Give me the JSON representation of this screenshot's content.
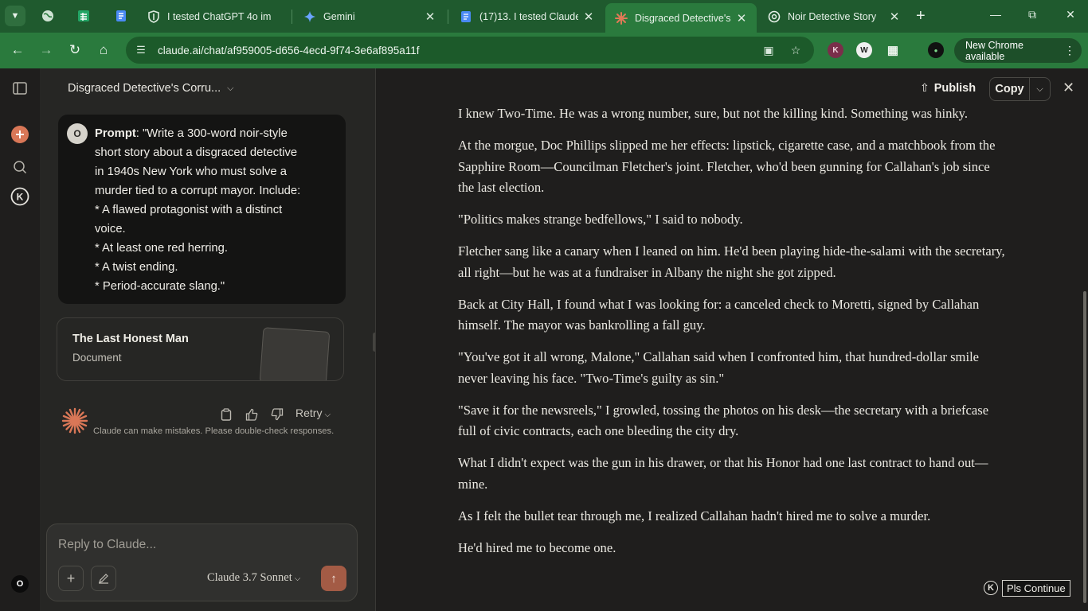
{
  "browser": {
    "tabs": [
      {
        "title": "I tested ChatGPT 4o im",
        "icon": "shield-icon",
        "active": false
      },
      {
        "title": "Gemini",
        "icon": "gemini-star-icon",
        "active": false
      },
      {
        "title": "(17)13. I tested Claude",
        "icon": "docs-icon",
        "active": false
      },
      {
        "title": "Disgraced Detective's C",
        "icon": "claude-spark-icon",
        "active": true
      },
      {
        "title": "Noir Detective Story",
        "icon": "chatgpt-icon",
        "active": false
      }
    ],
    "url": "claude.ai/chat/af959005-d656-4ecd-9f74-3e6af895a11f",
    "update_label": "New Chrome available"
  },
  "chat": {
    "title": "Disgraced Detective's Corru...",
    "user_initial": "O",
    "prompt_label": "Prompt",
    "prompt_lines": [
      ": \"Write a 300-word noir-style",
      "short story about a disgraced detective",
      "in 1940s New York who must solve a",
      "murder tied to a corrupt mayor. Include:",
      "* A flawed protagonist with a distinct",
      "voice.",
      "* At least one red herring.",
      "* A twist ending.",
      "* Period-accurate slang.\""
    ],
    "artifact_card": {
      "title": "The Last Honest Man",
      "type": "Document"
    },
    "retry_label": "Retry",
    "disclaimer": "Claude can make mistakes. Please double-check responses.",
    "reply_placeholder": "Reply to Claude...",
    "model": "Claude 3.7 Sonnet",
    "rail_user_initial": "O"
  },
  "artifact": {
    "publish_label": "Publish",
    "copy_label": "Copy",
    "paragraphs": [
      "I knew Two-Time. He was a wrong number, sure, but not the killing kind. Something was hinky.",
      "At the morgue, Doc Phillips slipped me her effects: lipstick, cigarette case, and a matchbook from the Sapphire Room—Councilman Fletcher's joint. Fletcher, who'd been gunning for Callahan's job since the last election.",
      "\"Politics makes strange bedfellows,\" I said to nobody.",
      "Fletcher sang like a canary when I leaned on him. He'd been playing hide-the-salami with the secretary, all right—but he was at a fundraiser in Albany the night she got zipped.",
      "Back at City Hall, I found what I was looking for: a canceled check to Moretti, signed by Callahan himself. The mayor was bankrolling a fall guy.",
      "\"You've got it all wrong, Malone,\" Callahan said when I confronted him, that hundred-dollar smile never leaving his face. \"Two-Time's guilty as sin.\"",
      "\"Save it for the newsreels,\" I growled, tossing the photos on his desk—the secretary with a briefcase full of civic contracts, each one bleeding the city dry.",
      "What I didn't expect was the gun in his drawer, or that his Honor had one last contract to hand out—mine.",
      "As I felt the bullet tear through me, I realized Callahan hadn't hired me to solve a murder.",
      "He'd hired me to become one."
    ],
    "continue_badge": "K",
    "continue_label": "Pls Continue"
  },
  "colors": {
    "browser_frame": "#1f5a2e",
    "accent": "#d97757",
    "send_button": "#a35b45"
  }
}
